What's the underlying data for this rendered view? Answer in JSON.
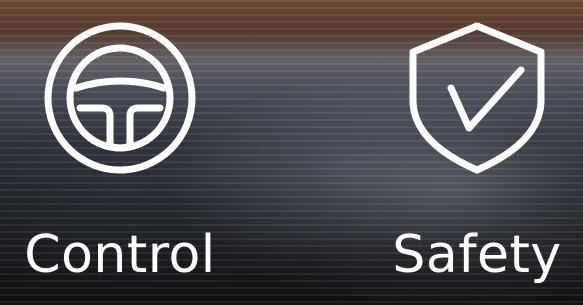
{
  "features": [
    {
      "label": "Control",
      "icon": "steering-wheel-icon"
    },
    {
      "label": "Safety",
      "icon": "shield-check-icon"
    }
  ],
  "colors": {
    "icon": "#ffffff",
    "text": "#ffffff"
  }
}
